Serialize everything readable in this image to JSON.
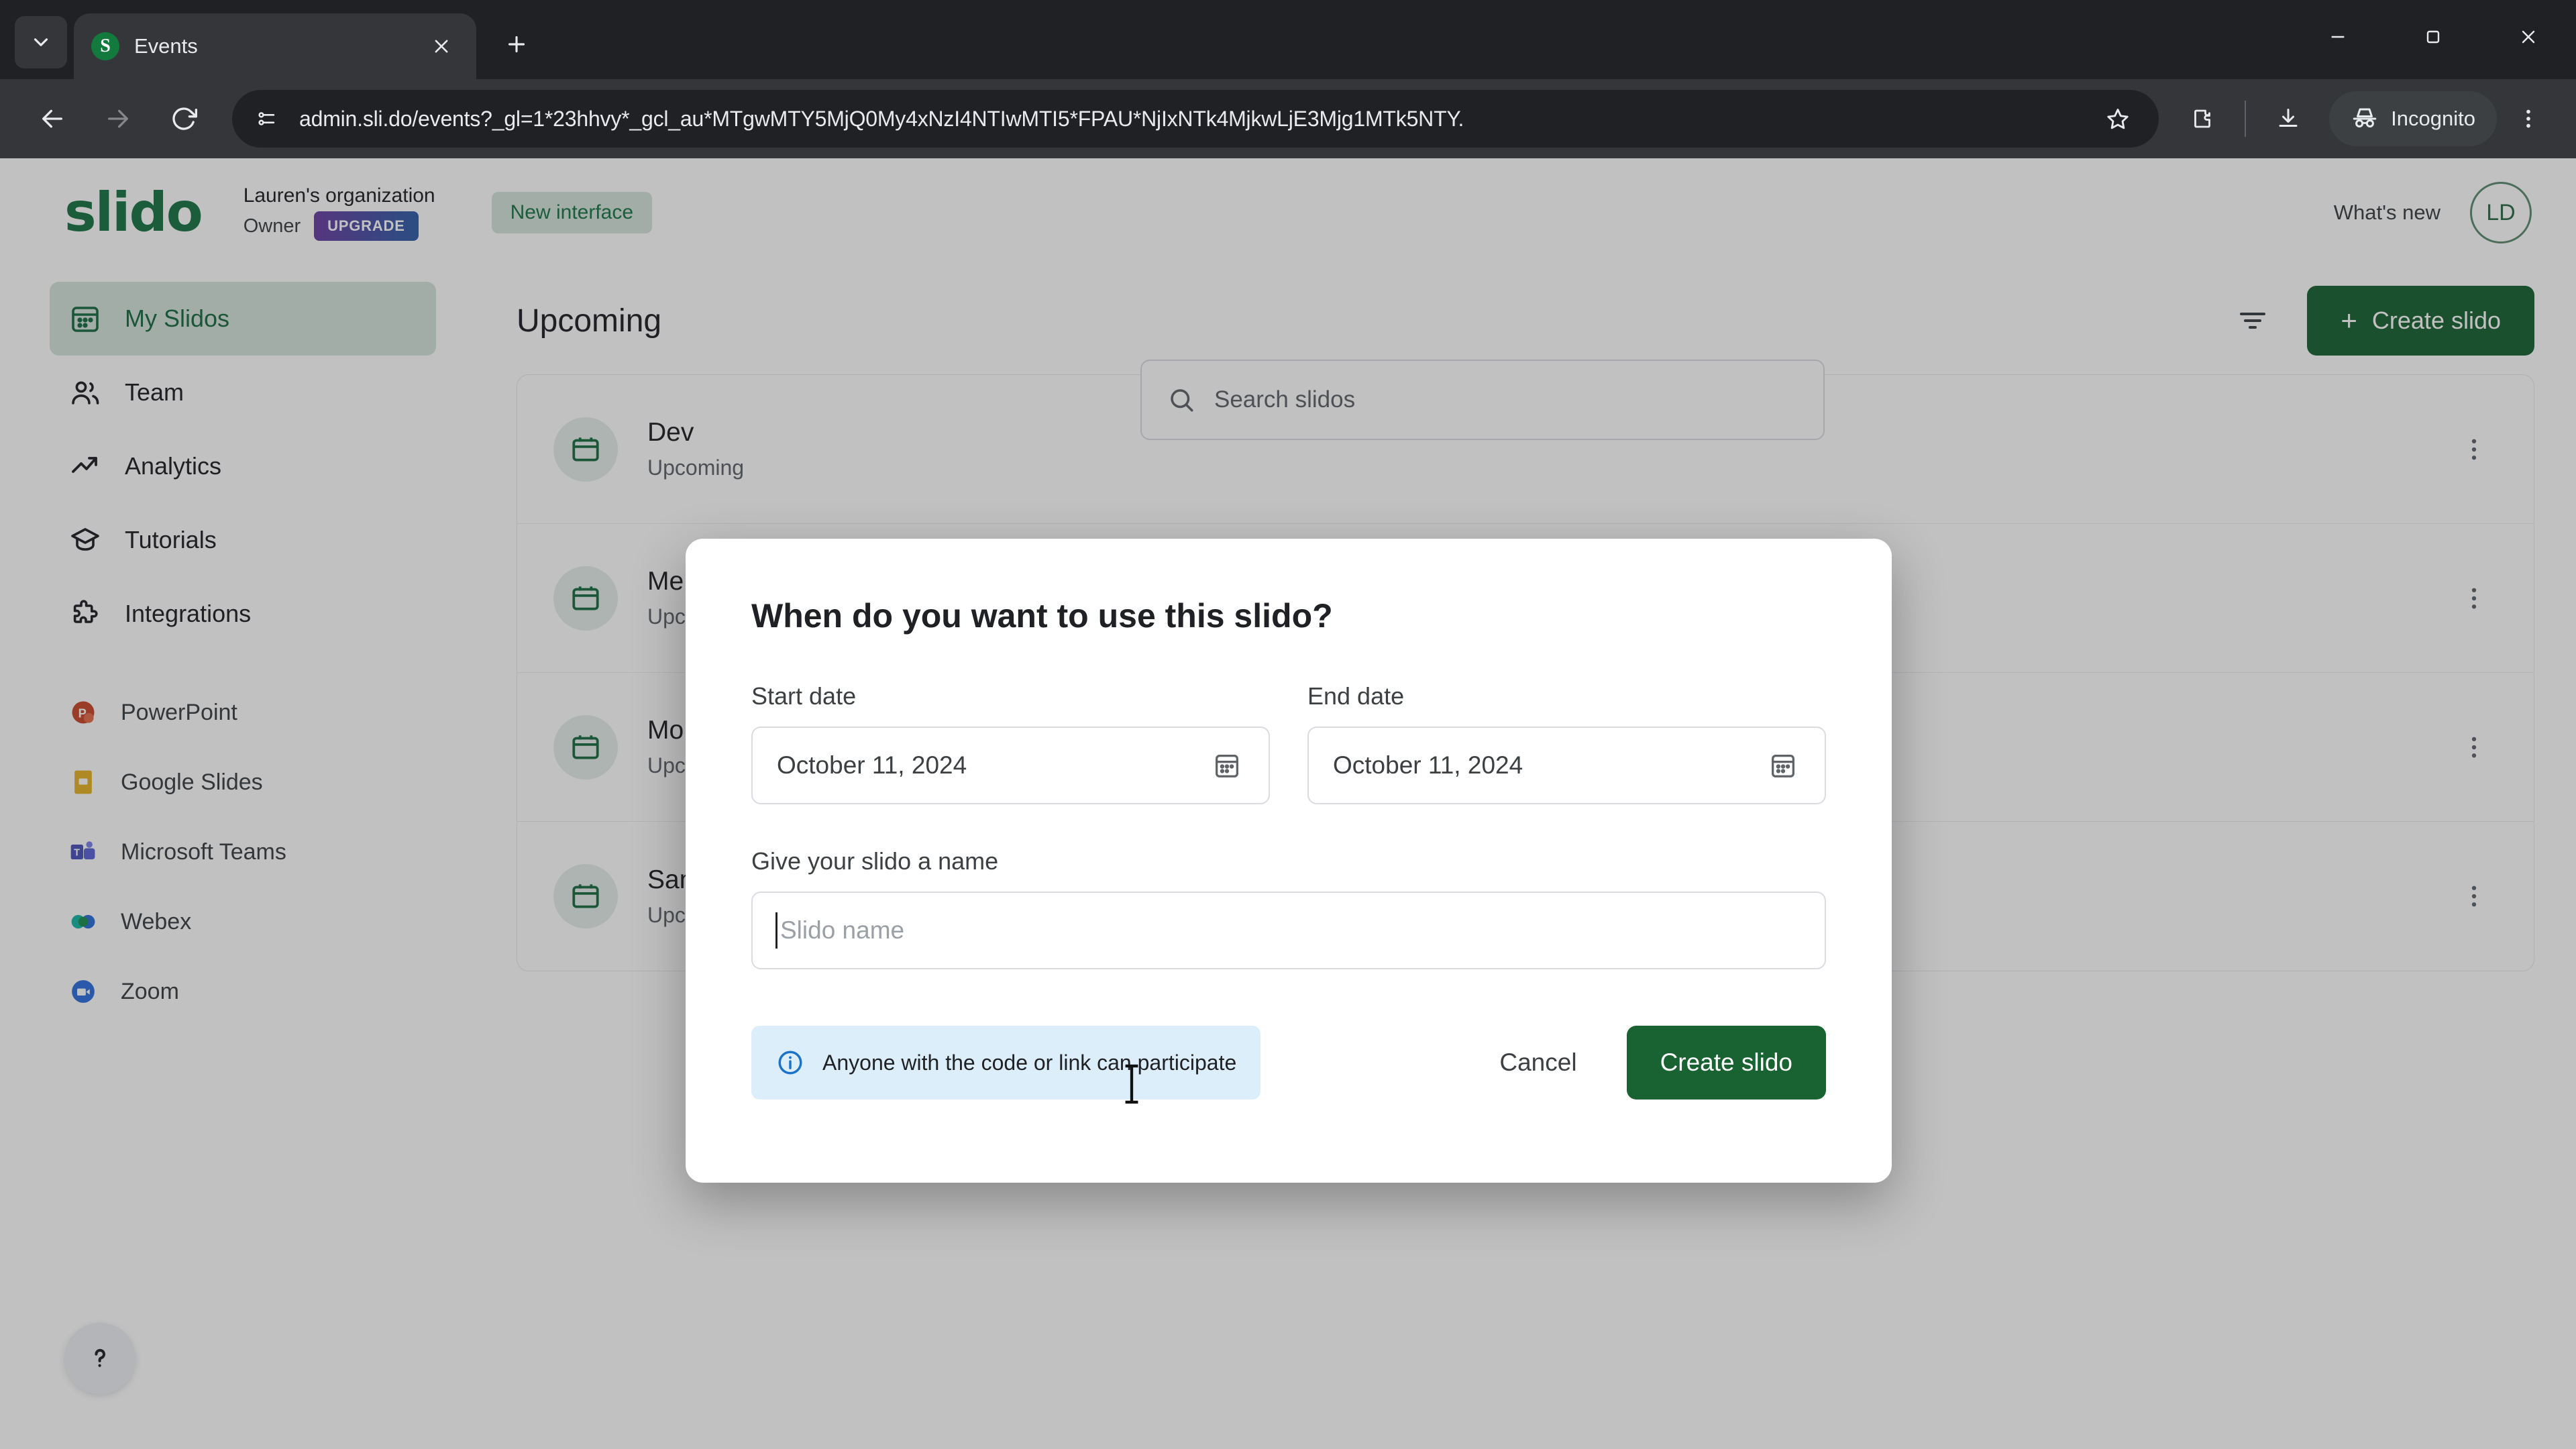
{
  "browser": {
    "tab": {
      "title": "Events",
      "favicon_letter": "S"
    },
    "tab_list_icon": "chevron-down-icon",
    "new_tab_label": "+",
    "window_controls": {
      "minimize": "minimize-icon",
      "maximize": "maximize-icon",
      "close": "close-icon"
    },
    "toolbar": {
      "back": "back-arrow-icon",
      "forward": "forward-arrow-icon",
      "reload": "reload-icon",
      "site_info": "site-settings-icon",
      "url": "admin.sli.do/events?_gl=1*23hhvy*_gcl_au*MTgwMTY5MjQ0My4xNzI4NTIwMTI5*FPAU*NjIxNTk4MjkwLjE3Mjg1MTk5NTY.",
      "bookmark": "star-icon",
      "extensions": "extensions-icon",
      "downloads": "download-icon",
      "incognito_label": "Incognito",
      "menu": "three-dot-menu-icon"
    }
  },
  "app": {
    "logo_text": "slido",
    "org_name": "Lauren's organization",
    "org_role": "Owner",
    "upgrade_label": "UPGRADE",
    "new_interface_label": "New interface",
    "whats_new_label": "What's new",
    "avatar_initials": "LD",
    "accent_green": "#196333",
    "light_green": "#d5e3da"
  },
  "search": {
    "placeholder": "Search slidos"
  },
  "sidebar": {
    "nav_items": [
      {
        "label": "My Slidos",
        "icon": "calendar-grid-icon",
        "active": true
      },
      {
        "label": "Team",
        "icon": "people-icon",
        "active": false
      },
      {
        "label": "Analytics",
        "icon": "trend-up-icon",
        "active": false
      },
      {
        "label": "Tutorials",
        "icon": "graduation-cap-icon",
        "active": false
      },
      {
        "label": "Integrations",
        "icon": "puzzle-piece-icon",
        "active": false
      }
    ],
    "integrations": [
      {
        "label": "PowerPoint",
        "icon": "powerpoint-icon",
        "color": "#c8492b"
      },
      {
        "label": "Google Slides",
        "icon": "google-slides-icon",
        "color": "#e6b325"
      },
      {
        "label": "Microsoft Teams",
        "icon": "microsoft-teams-icon",
        "color": "#5059c9"
      },
      {
        "label": "Webex",
        "icon": "webex-icon",
        "color": "#1aa3a3"
      },
      {
        "label": "Zoom",
        "icon": "zoom-icon",
        "color": "#2d8cff"
      }
    ],
    "help_icon": "question-mark-icon"
  },
  "main": {
    "title": "Upcoming",
    "filter_icon": "filter-icon",
    "create_button": {
      "label": "Create slido",
      "plus": "+"
    },
    "events": [
      {
        "name": "Dev",
        "code": "",
        "status": "Upcoming"
      },
      {
        "name": "Me",
        "code": "",
        "status": "Upcoming"
      },
      {
        "name": "Mo",
        "code": "",
        "status": "Upcoming"
      },
      {
        "name": "San",
        "code": "",
        "status": "Upcoming"
      }
    ],
    "row_menu_icon": "three-dot-menu-icon"
  },
  "modal": {
    "title": "When do you want to use this slido?",
    "start_date": {
      "label": "Start date",
      "value": "October 11, 2024",
      "icon": "calendar-icon"
    },
    "end_date": {
      "label": "End date",
      "value": "October 11, 2024",
      "icon": "calendar-icon"
    },
    "name_label": "Give your slido a name",
    "name_placeholder": "Slido name",
    "name_value": "",
    "info_text": "Anyone with the code or link can participate",
    "info_icon": "info-circle-icon",
    "cancel_label": "Cancel",
    "submit_label": "Create slido"
  }
}
